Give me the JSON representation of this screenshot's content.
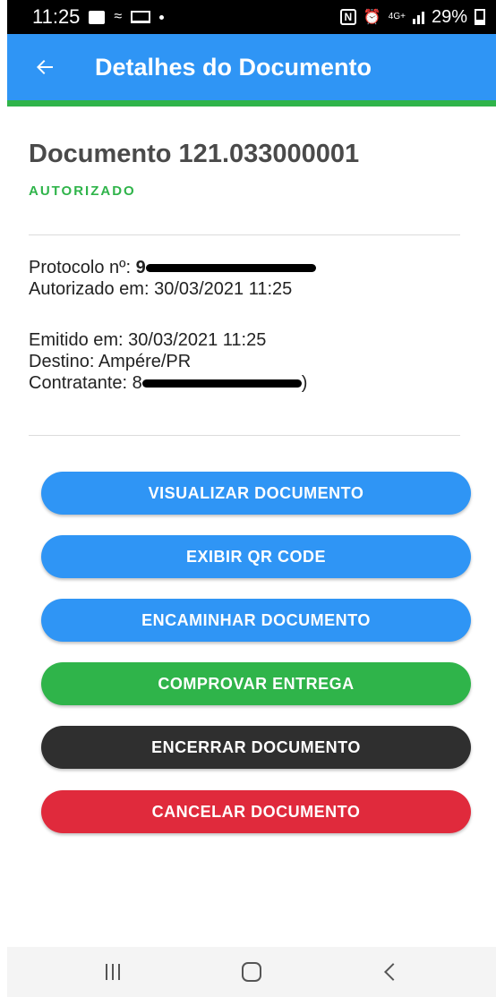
{
  "status_bar": {
    "time": "11:25",
    "network": "4G+",
    "battery": "29%"
  },
  "app_bar": {
    "title": "Detalhes do Documento",
    "back_icon": "arrow-left-icon"
  },
  "document": {
    "title": "Documento 121.033000001",
    "status": "AUTORIZADO",
    "protocolo_label": "Protocolo nº: ",
    "protocolo_value_visible": "9",
    "autorizado_em": "Autorizado em: 30/03/2021 11:25",
    "emitido_em": "Emitido em: 30/03/2021 11:25",
    "destino": "Destino: Ampére/PR",
    "contratante_label": "Contratante: 8",
    "contratante_suffix": ")"
  },
  "actions": {
    "visualizar": "VISUALIZAR DOCUMENTO",
    "qr_code": "EXIBIR QR CODE",
    "encaminhar": "ENCAMINHAR DOCUMENTO",
    "comprovar": "COMPROVAR ENTREGA",
    "encerrar": "ENCERRAR DOCUMENTO",
    "cancelar": "CANCELAR DOCUMENTO"
  },
  "colors": {
    "primary": "#2f95f5",
    "success": "#2fb44a",
    "dark": "#2f2f2f",
    "danger": "#e02a3c"
  }
}
